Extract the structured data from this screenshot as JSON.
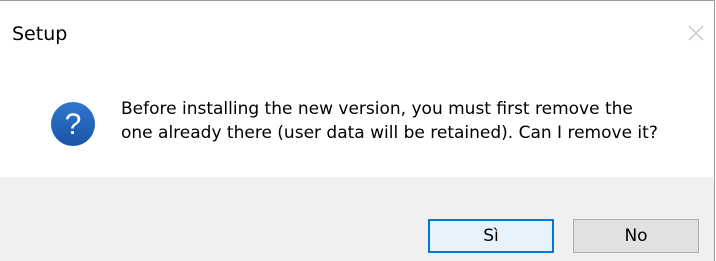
{
  "window": {
    "title": "Setup"
  },
  "dialog": {
    "icon": "question-icon",
    "message_line1": "Before installing the new version, you must first remove the",
    "message_line2": "one already there (user data will be retained). Can I remove it?"
  },
  "buttons": {
    "yes_label": "Sì",
    "no_label": "No"
  },
  "colors": {
    "icon_blue": "#1f5fb0",
    "default_button_border": "#0078d7",
    "footer_background": "#f0f0f0"
  }
}
